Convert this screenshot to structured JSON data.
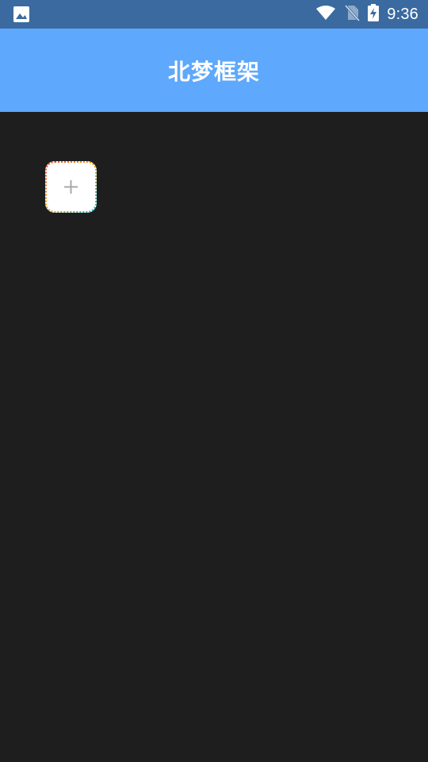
{
  "status_bar": {
    "left_icon": "image-icon",
    "wifi_icon": "wifi-icon",
    "signal_icon": "no-sim-icon",
    "battery_icon": "battery-charging-icon",
    "time": "9:36"
  },
  "app_bar": {
    "title": "北梦框架",
    "background": "#5ea8fd"
  },
  "content": {
    "background": "#1e1e1e",
    "add_button": {
      "icon": "plus-icon",
      "border_colors": [
        "#e53935",
        "#ff9800",
        "#00bcd4"
      ]
    }
  }
}
